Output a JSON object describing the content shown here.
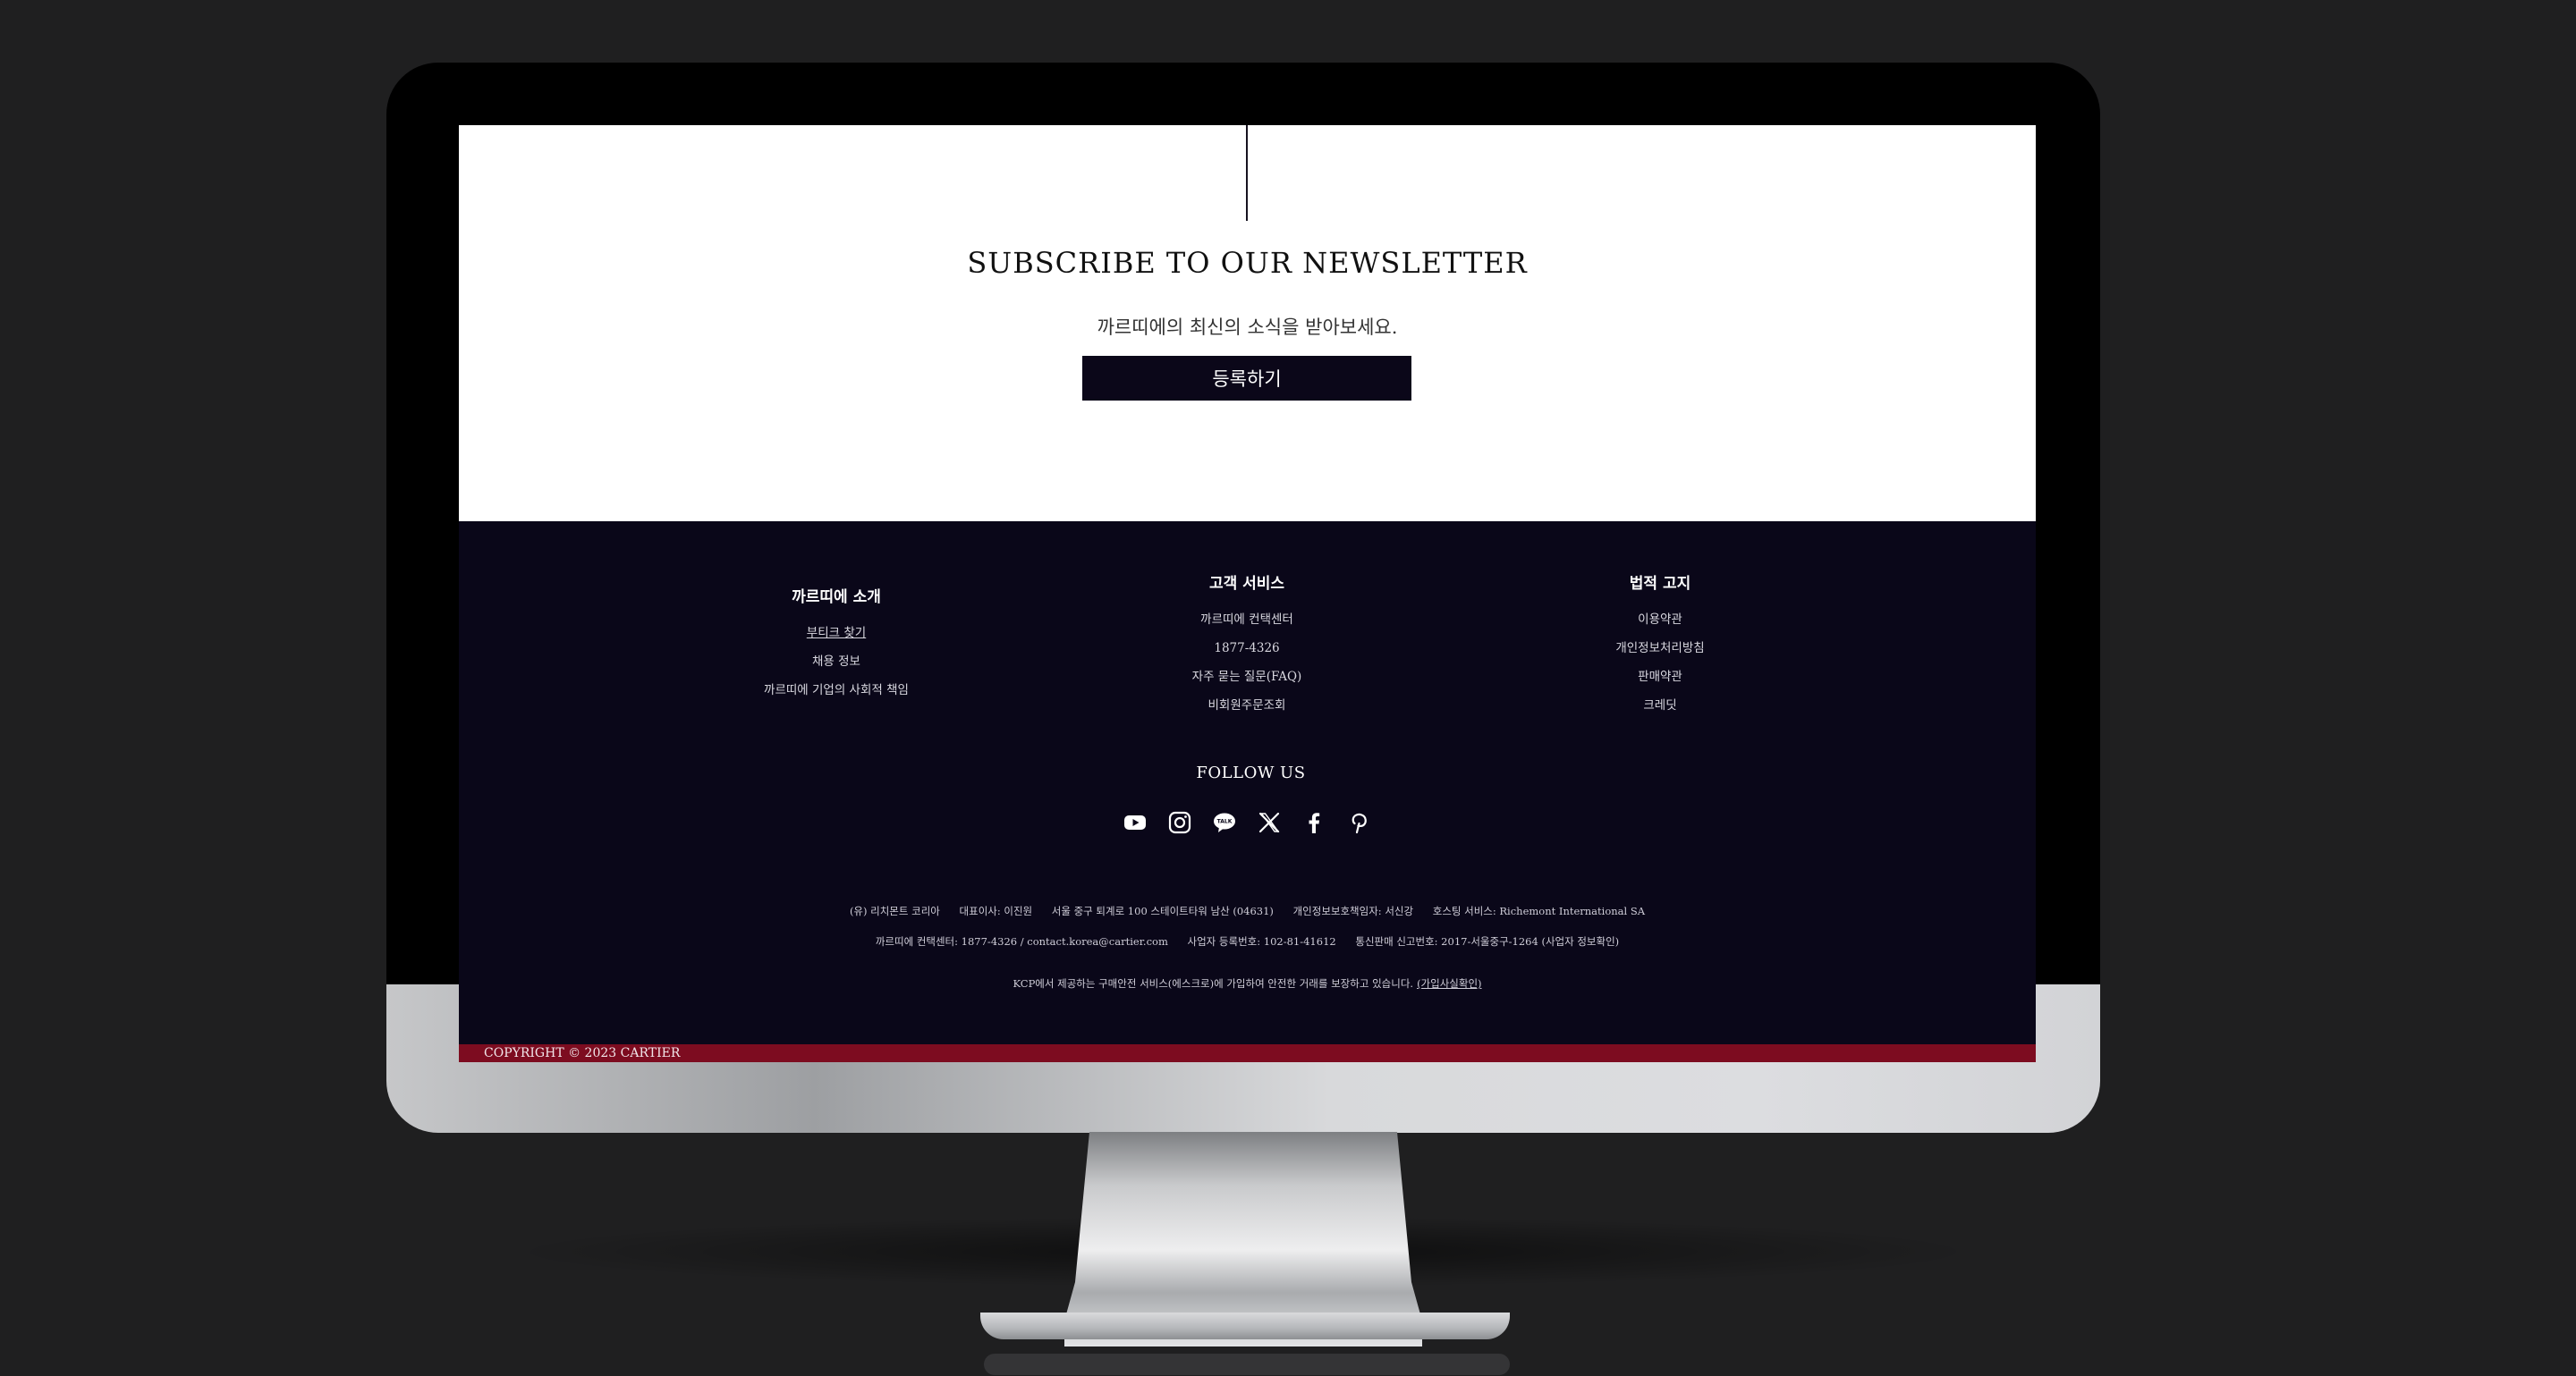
{
  "newsletter": {
    "title": "SUBSCRIBE TO OUR NEWSLETTER",
    "subtitle": "까르띠에의 최신의 소식을 받아보세요.",
    "button_label": "등록하기"
  },
  "footer": {
    "about": {
      "heading": "까르띠에 소개",
      "links": [
        "부티크 찾기",
        "채용 정보",
        "까르띠에 기업의 사회적 책임"
      ]
    },
    "service": {
      "heading": "고객 서비스",
      "links": [
        "까르띠에 컨택센터",
        "1877-4326",
        "자주 묻는 질문(FAQ)",
        "비회원주문조회"
      ]
    },
    "legal": {
      "heading": "법적 고지",
      "links": [
        "이용약관",
        "개인정보처리방침",
        "판매약관",
        "크레딧"
      ]
    },
    "follow_us": "FOLLOW US",
    "social_icons": [
      "youtube-icon",
      "instagram-icon",
      "kakaotalk-icon",
      "x-icon",
      "facebook-icon",
      "pinterest-icon"
    ],
    "info_line1": [
      "(유) 리치몬트 코리아",
      "대표이사: 이진원",
      "서울 중구 퇴계로 100 스테이트타워 남산 (04631)",
      "개인정보보호책임자: 서신강",
      "호스팅 서비스: Richemont International SA"
    ],
    "info_line2": [
      "까르띠에 컨택센터: 1877-4326 / contact.korea@cartier.com",
      "사업자 등록번호: 102-81-41612",
      "통신판매 신고번호: 2017-서울중구-1264 (사업자 정보확인)"
    ],
    "info_line3_text": "KCP에서 제공하는 구매안전 서비스(에스크로)에 가입하여 안전한 거래를 보장하고 있습니다.",
    "info_line3_link": "(가입사실확인)",
    "copyright": "COPYRIGHT © 2023 CARTIER"
  },
  "colors": {
    "footer_bg": "#0a0719",
    "button_bg": "#0b0719",
    "copyright_bar": "#7d0c20"
  }
}
